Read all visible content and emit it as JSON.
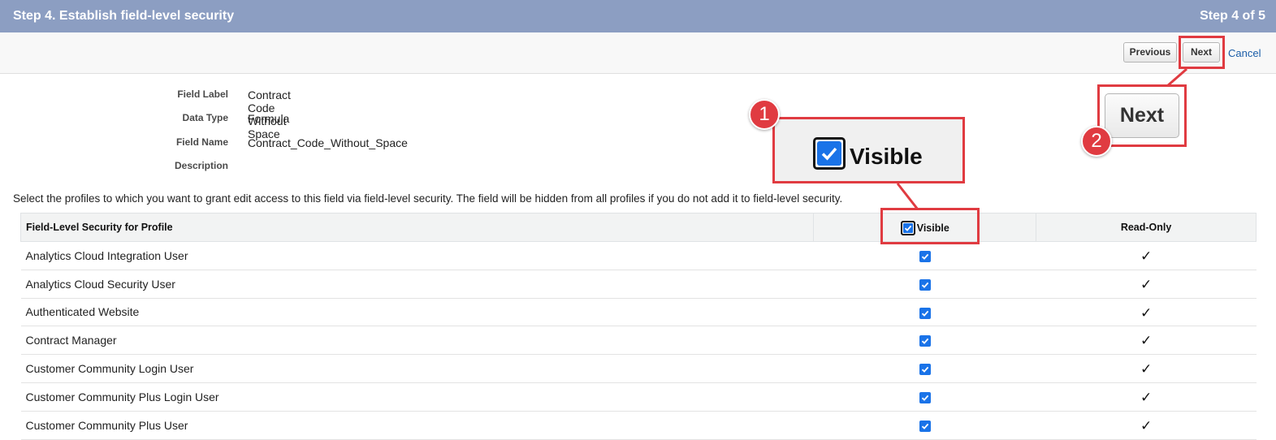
{
  "header": {
    "title": "Step 4. Establish field-level security",
    "step": "Step 4 of 5"
  },
  "toolbar": {
    "previous_label": "Previous",
    "next_label": "Next",
    "cancel_label": "Cancel"
  },
  "field_info": {
    "label_label": "Field Label",
    "label_value": "Contract Code Without Space",
    "type_label": "Data Type",
    "type_value": "Formula",
    "name_label": "Field Name",
    "name_value": "Contract_Code_Without_Space",
    "description_label": "Description",
    "description_value": ""
  },
  "instructions": "Select the profiles to which you want to grant edit access to this field via field-level security. The field will be hidden from all profiles if you do not add it to field-level security.",
  "table": {
    "columns": [
      "Field-Level Security for Profile",
      "Visible",
      "Read-Only"
    ],
    "rows": [
      {
        "profile": "Analytics Cloud Integration User",
        "visible": true,
        "read_only": true
      },
      {
        "profile": "Analytics Cloud Security User",
        "visible": true,
        "read_only": true
      },
      {
        "profile": "Authenticated Website",
        "visible": true,
        "read_only": true
      },
      {
        "profile": "Contract Manager",
        "visible": true,
        "read_only": true
      },
      {
        "profile": "Customer Community Login User",
        "visible": true,
        "read_only": true
      },
      {
        "profile": "Customer Community Plus Login User",
        "visible": true,
        "read_only": true
      },
      {
        "profile": "Customer Community Plus User",
        "visible": true,
        "read_only": true
      }
    ]
  },
  "annotations": {
    "badge_1": "1",
    "badge_2": "2",
    "zoom_visible_label": "Visible",
    "zoom_next_label": "Next",
    "highlight_color": "#e03b41"
  },
  "colors": {
    "header_bg": "#8c9ec2",
    "checkbox": "#1a73e8",
    "link": "#1a5da8"
  }
}
